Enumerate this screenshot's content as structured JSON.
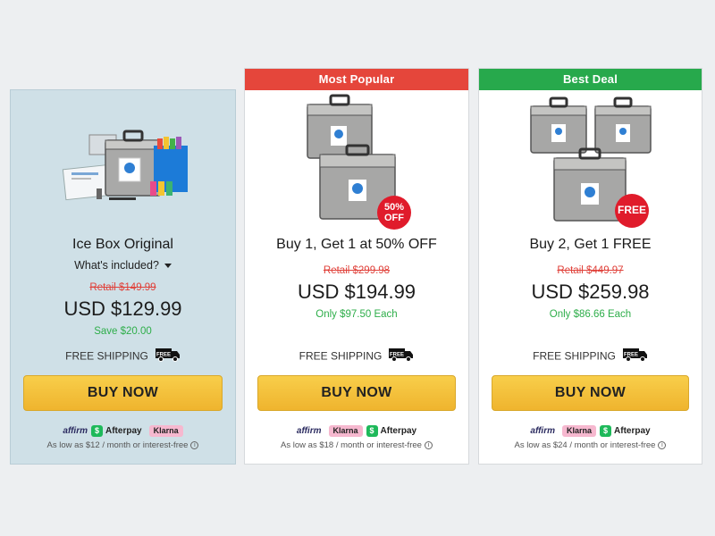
{
  "cards": [
    {
      "ribbon": "",
      "title": "Ice Box Original",
      "whats_included": "What's included?",
      "retail": "Retail $149.99",
      "price": "USD $129.99",
      "sub": "Save $20.00",
      "shipping": "FREE SHIPPING",
      "truck_label": "FREE",
      "buy": "BUY NOW",
      "affirm": "affirm",
      "afterpay": "Afterpay",
      "klarna": "Klarna",
      "as_low": "As low as $12 / month or interest-free"
    },
    {
      "ribbon": "Most Popular",
      "title": "Buy 1, Get 1 at 50% OFF",
      "retail": "Retail $299.98",
      "price": "USD $194.99",
      "sub": "Only $97.50 Each",
      "shipping": "FREE SHIPPING",
      "truck_label": "FREE",
      "badge_line1": "50%",
      "badge_line2": "OFF",
      "buy": "BUY NOW",
      "affirm": "affirm",
      "klarna": "Klarna",
      "afterpay": "Afterpay",
      "as_low": "As low as $18 / month or interest-free"
    },
    {
      "ribbon": "Best Deal",
      "title": "Buy 2, Get 1 FREE",
      "retail": "Retail $449.97",
      "price": "USD $259.98",
      "sub": "Only $86.66 Each",
      "shipping": "FREE SHIPPING",
      "truck_label": "FREE",
      "badge_line1": "FREE",
      "buy": "BUY NOW",
      "affirm": "affirm",
      "klarna": "Klarna",
      "afterpay": "Afterpay",
      "as_low": "As low as $24 / month or interest-free"
    }
  ],
  "colors": {
    "ribbon_popular": "#e5463b",
    "ribbon_best": "#27a94c",
    "retail": "#e0413a",
    "savings": "#2eae4a",
    "buy_button": "#f5c242",
    "badge": "#e01b2b"
  }
}
